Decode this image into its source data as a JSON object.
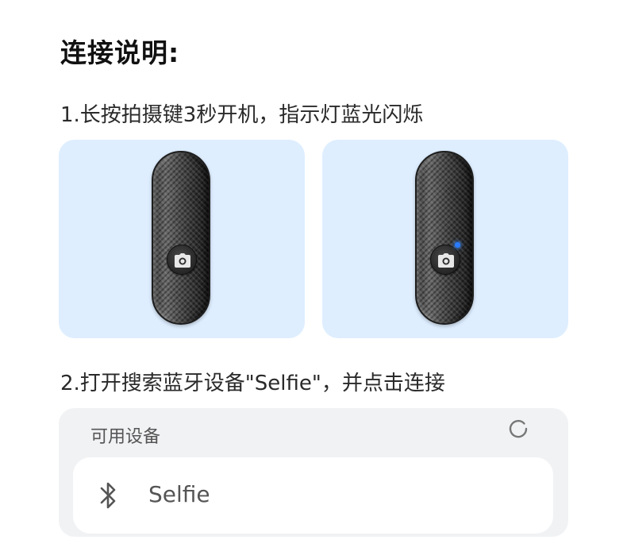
{
  "title": "连接说明:",
  "steps": [
    {
      "label": "1.长按拍摄键3秒开机，指示灯蓝光闪烁"
    },
    {
      "label": "2.打开搜索蓝牙设备\"Selfie\"，并点击连接"
    }
  ],
  "illustrations": [
    {
      "device": "selfie-remote",
      "icon": "camera-icon",
      "led_on": false
    },
    {
      "device": "selfie-remote",
      "icon": "camera-icon",
      "led_on": true,
      "led_color": "#2a7bff"
    }
  ],
  "bluetooth": {
    "header": "可用设备",
    "refresh_icon": "refresh-icon",
    "devices": [
      {
        "icon": "bluetooth-icon",
        "name": "Selfie"
      }
    ]
  },
  "colors": {
    "panel_background": "#deeeff",
    "list_background": "#f1f2f4",
    "led": "#2a7bff"
  }
}
